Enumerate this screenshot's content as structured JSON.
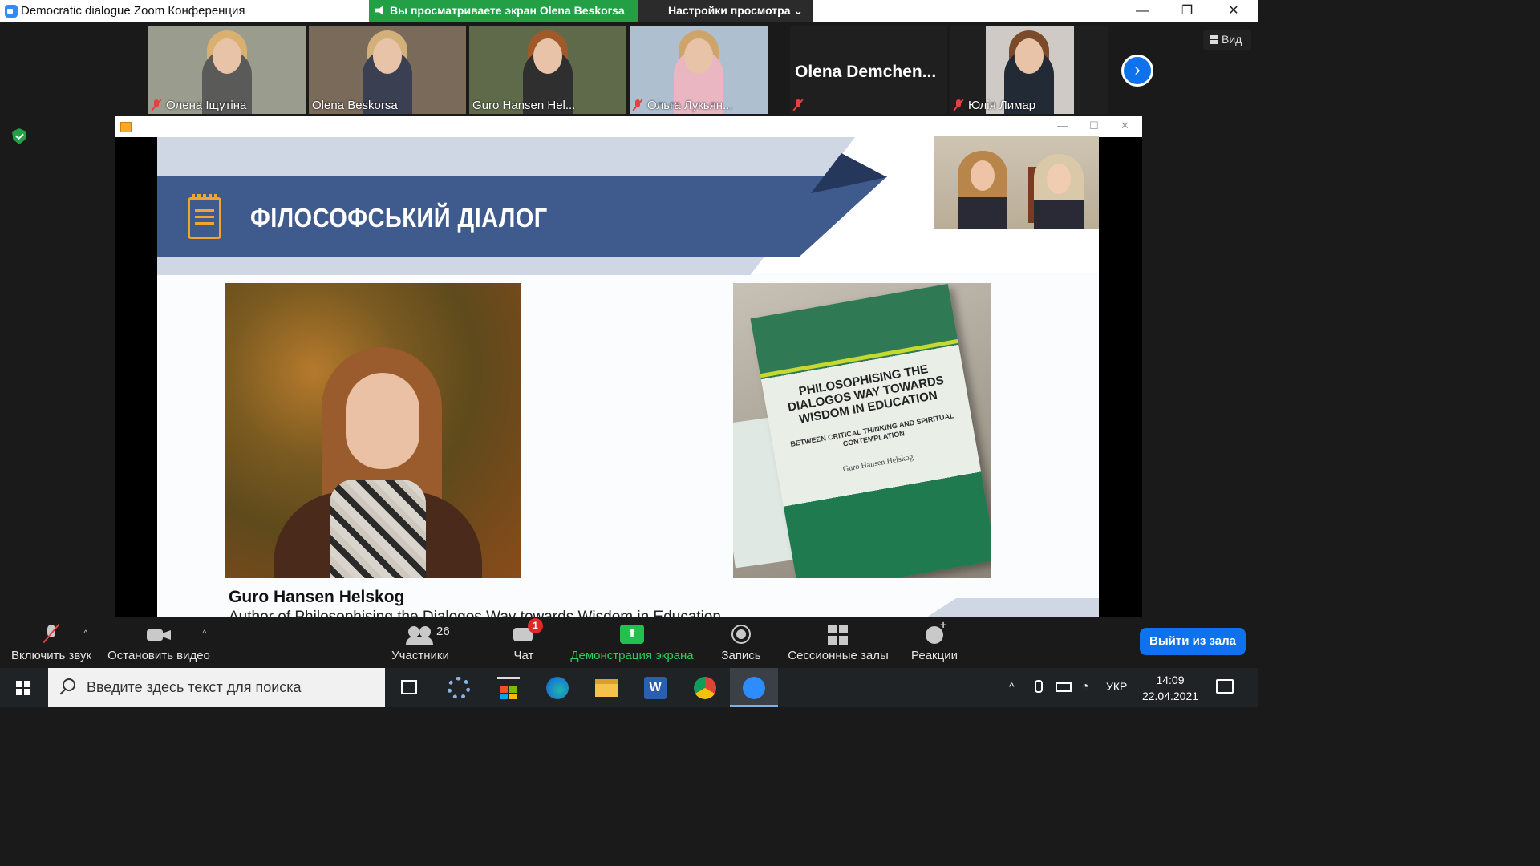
{
  "window": {
    "app_name": "Democratic dialogue",
    "title": "Zoom Конференция",
    "share_banner": "Вы просматриваете экран Olena Beskorsa",
    "view_settings": "Настройки просмотра",
    "controls": {
      "minimize": "—",
      "restore": "❐",
      "close": "✕"
    }
  },
  "participants": [
    {
      "name": "Олена Іщутіна",
      "muted": true,
      "bg": "#9a9c8e",
      "clothes": "#5a5a58",
      "hair": "#d9b070"
    },
    {
      "name": "Olena Beskorsa",
      "muted": false,
      "bg": "#7a6a5a",
      "clothes": "#3a3f52",
      "hair": "#d2b07a"
    },
    {
      "name": "Guro Hansen Hel...",
      "muted": false,
      "active": true,
      "bg": "#5e6a4a",
      "clothes": "#2f2f2f",
      "hair": "#a05a2a"
    },
    {
      "name": "Ольга Лукьян...",
      "muted": true,
      "bg": "#aebfd0",
      "clothes": "#e9b6c2",
      "hair": "#cfa46a"
    },
    {
      "name": "Olena  Demchen...",
      "muted": true,
      "text_tile": true
    },
    {
      "name": "Юлія Лимар",
      "muted": true,
      "bg": "#cfcac6",
      "clothes": "#222a36",
      "hair": "#7a4a2a"
    }
  ],
  "view_button": "Вид",
  "next_page": "›",
  "slide": {
    "title": "ФІЛОСОФСЬКИЙ ДІАЛОГ",
    "book_title": "PHILOSOPHISING THE DIALOGOS WAY TOWARDS WISDOM IN EDUCATION",
    "book_subtitle": "BETWEEN CRITICAL THINKING AND SPIRITUAL CONTEMPLATION",
    "book_author": "Guro Hansen Helskog",
    "caption_name": "Guro Hansen Helskog",
    "caption_sub": "Author of Philosophising the Dialogos Way towards Wisdom in Education"
  },
  "toolbar": {
    "mute": "Включить звук",
    "video": "Остановить видео",
    "participants": "Участники",
    "participants_count": "26",
    "chat": "Чат",
    "chat_badge": "1",
    "share": "Демонстрация экрана",
    "record": "Запись",
    "rooms": "Сессионные залы",
    "reactions": "Реакции",
    "leave": "Выйти из зала"
  },
  "taskbar": {
    "search_placeholder": "Введите здесь текст для поиска",
    "language": "УКР",
    "time": "14:09",
    "date": "22.04.2021",
    "apps": [
      "task-view",
      "settings",
      "store",
      "edge",
      "explorer",
      "word",
      "chrome",
      "zoom"
    ]
  },
  "colors": {
    "accent": "#0e72ed",
    "green": "#23a046",
    "slide_band": "#3f5a8c"
  }
}
